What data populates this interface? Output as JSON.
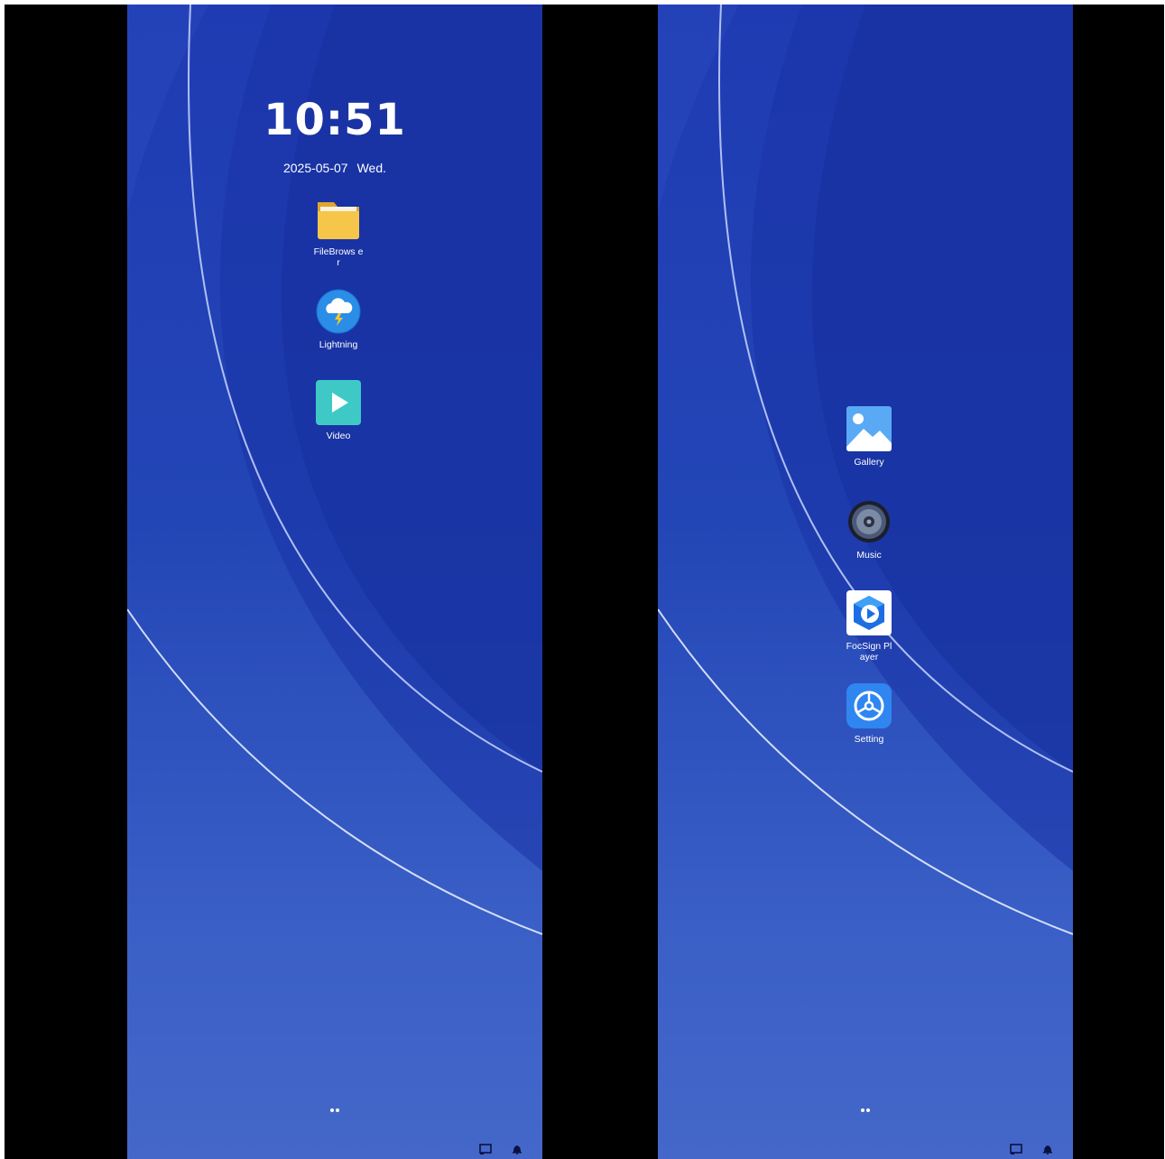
{
  "screen_left": {
    "clock": "10:51",
    "date": "2025-05-07",
    "weekday": "Wed.",
    "apps": [
      {
        "label": "FileBrows er",
        "icon": "folder-icon"
      },
      {
        "label": "Lightning",
        "icon": "cloud-lightning-icon"
      },
      {
        "label": "Video",
        "icon": "play-icon"
      }
    ]
  },
  "screen_right": {
    "apps": [
      {
        "label": "Gallery",
        "icon": "gallery-icon"
      },
      {
        "label": "Music",
        "icon": "speaker-icon"
      },
      {
        "label": "FocSign Player",
        "icon": "focsign-player-icon"
      },
      {
        "label": "Setting",
        "icon": "settings-icon"
      }
    ]
  },
  "page_indicator": {
    "pages": 2
  },
  "system_tray": [
    "screen-icon",
    "notification-bell-icon"
  ],
  "colors": {
    "wallpaper_top": "#1f3bb3",
    "wallpaper_bottom": "#4467c9",
    "text": "#ffffff"
  }
}
